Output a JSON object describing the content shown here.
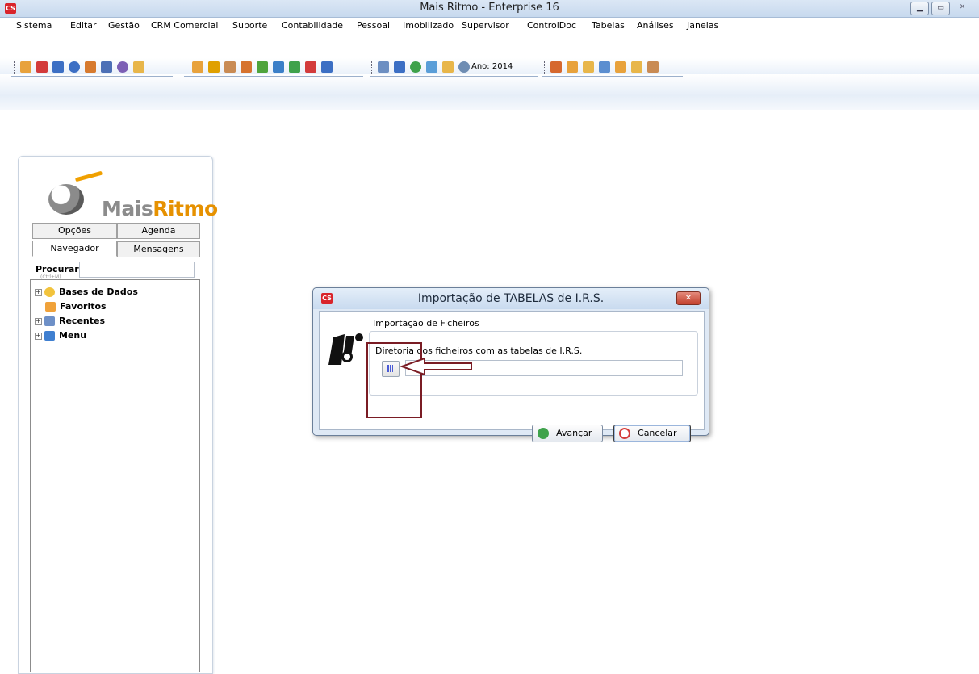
{
  "window": {
    "title": "Mais Ritmo - Enterprise 16",
    "controls": [
      "minimize-icon",
      "maximize-icon",
      "close-icon"
    ]
  },
  "menu": {
    "items": [
      {
        "label": "Sistema"
      },
      {
        "label": "Editar"
      },
      {
        "label": "Gestão"
      },
      {
        "label": "CRM Comercial"
      },
      {
        "label": "Suporte"
      },
      {
        "label": "Contabilidade"
      },
      {
        "label": "Pessoal"
      },
      {
        "label": "Imobilizado"
      },
      {
        "label": "Supervisor"
      },
      {
        "label": "ControlDoc"
      },
      {
        "label": "Tabelas"
      },
      {
        "label": "Análises"
      },
      {
        "label": "Janelas"
      }
    ]
  },
  "toolbar": {
    "year_label": "Ano: 2014",
    "colors": {
      "orange": "#e8a23c",
      "blue": "#3c6fc4",
      "green": "#3fa24b",
      "red": "#d33b3b"
    }
  },
  "left_panel": {
    "logo_mais": "Mais",
    "logo_ritmo": "Ritmo",
    "tabs_row1": [
      {
        "label": "Opções"
      },
      {
        "label": "Agenda"
      }
    ],
    "tabs_row2": [
      {
        "label": "Navegador"
      },
      {
        "label": "Mensagens"
      }
    ],
    "search_label": "Procurar :",
    "search_hint": "(Ctrl+M)",
    "tree": [
      {
        "label": "Bases de Dados",
        "icon": "database-icon"
      },
      {
        "label": "Favoritos",
        "icon": "favorites-icon"
      },
      {
        "label": "Recentes",
        "icon": "recent-icon"
      },
      {
        "label": "Menu",
        "icon": "menu-icon"
      }
    ]
  },
  "dialog": {
    "title": "Importação de TABELAS de I.R.S.",
    "group_title": "Importação de Ficheiros",
    "field_label": "Diretoria dos ficheiros com as tabelas de I.R.S.",
    "path_value": "",
    "buttons": {
      "next_prefix": "A",
      "next_rest": "vançar",
      "cancel_prefix": "C",
      "cancel_rest": "ancelar"
    },
    "highlight_color": "#7a1c24"
  }
}
